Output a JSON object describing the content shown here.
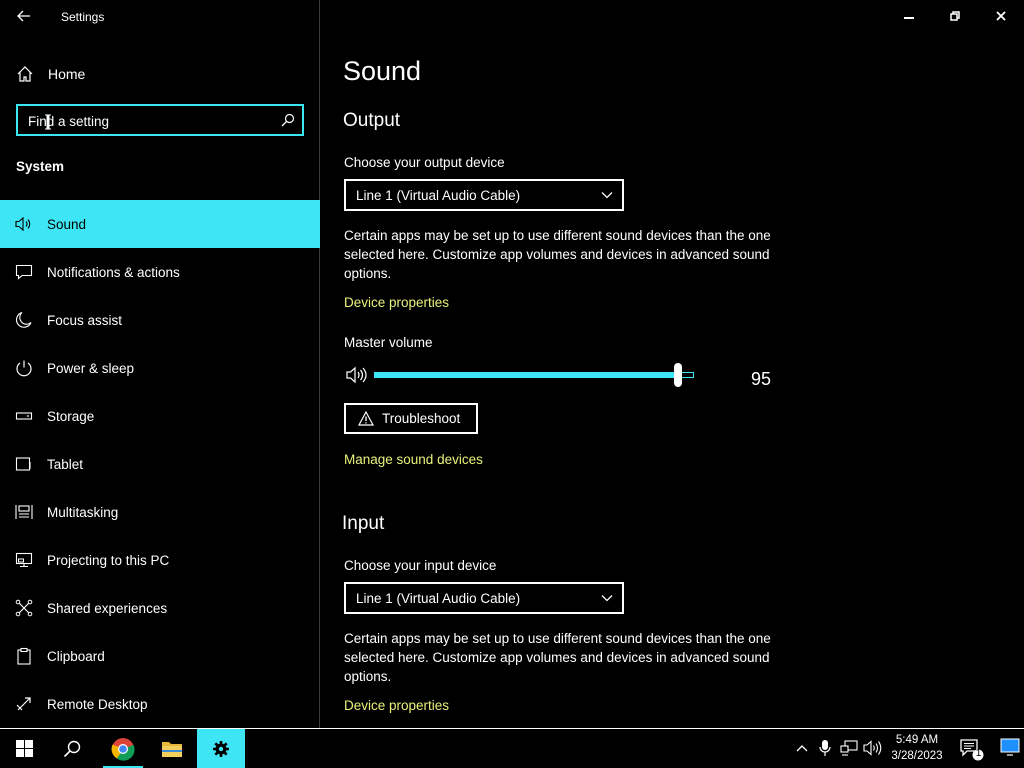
{
  "window": {
    "app_title": "Settings"
  },
  "sidebar": {
    "home_label": "Home",
    "search_placeholder": "Find a setting",
    "section_heading": "System",
    "items": [
      {
        "label": "Sound",
        "icon": "speaker-icon",
        "active": true
      },
      {
        "label": "Notifications & actions",
        "icon": "notification-icon",
        "active": false
      },
      {
        "label": "Focus assist",
        "icon": "moon-icon",
        "active": false
      },
      {
        "label": "Power & sleep",
        "icon": "power-icon",
        "active": false
      },
      {
        "label": "Storage",
        "icon": "storage-icon",
        "active": false
      },
      {
        "label": "Tablet",
        "icon": "tablet-icon",
        "active": false
      },
      {
        "label": "Multitasking",
        "icon": "multitasking-icon",
        "active": false
      },
      {
        "label": "Projecting to this PC",
        "icon": "projecting-icon",
        "active": false
      },
      {
        "label": "Shared experiences",
        "icon": "shared-experiences-icon",
        "active": false
      },
      {
        "label": "Clipboard",
        "icon": "clipboard-icon",
        "active": false
      },
      {
        "label": "Remote Desktop",
        "icon": "remote-desktop-icon",
        "active": false
      }
    ]
  },
  "main": {
    "page_title": "Sound",
    "output": {
      "heading": "Output",
      "device_label": "Choose your output device",
      "device_value": "Line 1 (Virtual Audio Cable)",
      "note": "Certain apps may be set up to use different sound devices than the one selected here. Customize app volumes and devices in advanced sound options.",
      "device_properties_link": "Device properties",
      "master_volume_label": "Master volume",
      "volume_value": "95",
      "volume_fraction": 0.95,
      "troubleshoot_label": "Troubleshoot",
      "manage_link": "Manage sound devices"
    },
    "input": {
      "heading": "Input",
      "device_label": "Choose your input device",
      "device_value": "Line 1 (Virtual Audio Cable)",
      "note": "Certain apps may be set up to use different sound devices than the one selected here. Customize app volumes and devices in advanced sound options.",
      "device_properties_link": "Device properties"
    }
  },
  "taskbar": {
    "time": "5:49 AM",
    "date": "3/28/2023",
    "notification_count": "1"
  },
  "colors": {
    "accent": "#3ee6f5",
    "link": "#e8f27a",
    "background": "#000000",
    "text": "#ffffff"
  }
}
